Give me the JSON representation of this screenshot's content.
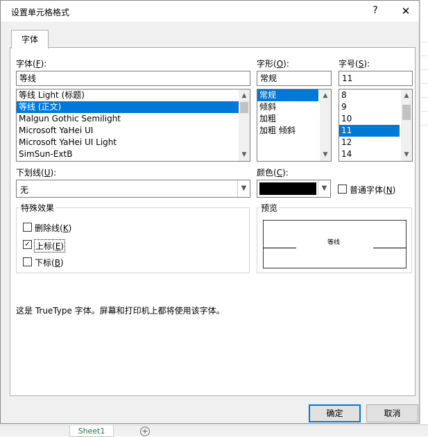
{
  "window": {
    "title": "设置单元格格式",
    "help_glyph": "?",
    "close_glyph": "✕"
  },
  "tabs": [
    {
      "label": "字体"
    }
  ],
  "font": {
    "label": "字体(F):",
    "value": "等线",
    "items": [
      "等线 Light (标题)",
      "等线 (正文)",
      "Malgun Gothic Semilight",
      "Microsoft YaHei UI",
      "Microsoft YaHei UI Light",
      "SimSun-ExtB"
    ],
    "selected_index": 1
  },
  "style": {
    "label": "字形(O):",
    "value": "常规",
    "items": [
      "常规",
      "倾斜",
      "加粗",
      "加粗 倾斜"
    ],
    "selected_index": 0
  },
  "size": {
    "label": "字号(S):",
    "value": "11",
    "items": [
      "8",
      "9",
      "10",
      "11",
      "12",
      "14"
    ],
    "selected_index": 3
  },
  "underline": {
    "label": "下划线(U):",
    "value": "无"
  },
  "color": {
    "label": "颜色(C):",
    "swatch": "#000000"
  },
  "normal_font": {
    "label": "普通字体(N)",
    "checked": false
  },
  "effects": {
    "title": "特殊效果",
    "strikethrough": {
      "label": "删除线(K)",
      "checked": false
    },
    "superscript": {
      "label": "上标(E)",
      "checked": true
    },
    "subscript": {
      "label": "下标(B)",
      "checked": false
    }
  },
  "preview": {
    "title": "预览",
    "sample": "等线"
  },
  "info_text": "这是 TrueType 字体。屏幕和打印机上都将使用该字体。",
  "buttons": {
    "ok": "确定",
    "cancel": "取消"
  },
  "sheet": {
    "tab": "Sheet1",
    "add_glyph": "+"
  },
  "colors": {
    "selection": "#0078d7",
    "default_button_border": "#0078d7"
  }
}
